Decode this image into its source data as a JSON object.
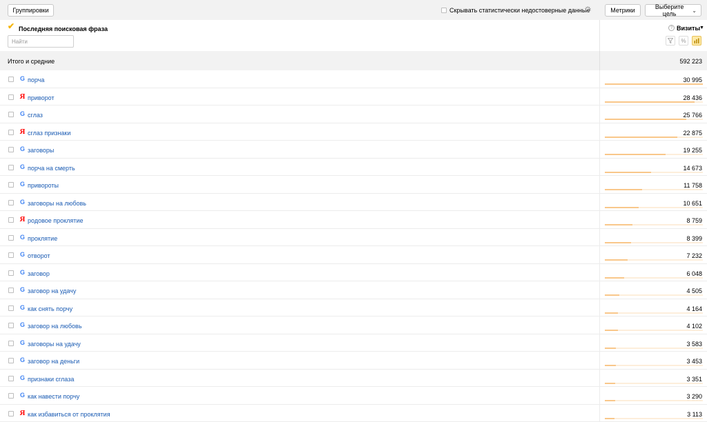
{
  "toolbar": {
    "groupings_label": "Группировки",
    "hide_unreliable_label": "Скрывать статистически недостоверные данные",
    "metrics_label": "Метрики",
    "goal_label": "Выберите цель"
  },
  "table": {
    "dimension_title": "Последняя поисковая фраза",
    "search_placeholder": "Найти",
    "metric_title": "Визиты",
    "totals_label": "Итого и средние",
    "totals_value": "592 223",
    "max_value": 30995,
    "rows": [
      {
        "source": "google",
        "phrase": "порча",
        "visits": "30 995",
        "value": 30995
      },
      {
        "source": "yandex",
        "phrase": "приворот",
        "visits": "28 436",
        "value": 28436
      },
      {
        "source": "google",
        "phrase": "сглаз",
        "visits": "25 766",
        "value": 25766
      },
      {
        "source": "yandex",
        "phrase": "сглаз признаки",
        "visits": "22 875",
        "value": 22875
      },
      {
        "source": "google",
        "phrase": "заговоры",
        "visits": "19 255",
        "value": 19255
      },
      {
        "source": "google",
        "phrase": "порча на смерть",
        "visits": "14 673",
        "value": 14673
      },
      {
        "source": "google",
        "phrase": "привороты",
        "visits": "11 758",
        "value": 11758
      },
      {
        "source": "google",
        "phrase": "заговоры на любовь",
        "visits": "10 651",
        "value": 10651
      },
      {
        "source": "yandex",
        "phrase": "родовое проклятие",
        "visits": "8 759",
        "value": 8759
      },
      {
        "source": "google",
        "phrase": "проклятие",
        "visits": "8 399",
        "value": 8399
      },
      {
        "source": "google",
        "phrase": "отворот",
        "visits": "7 232",
        "value": 7232
      },
      {
        "source": "google",
        "phrase": "заговор",
        "visits": "6 048",
        "value": 6048
      },
      {
        "source": "google",
        "phrase": "заговор на удачу",
        "visits": "4 505",
        "value": 4505
      },
      {
        "source": "google",
        "phrase": "как снять порчу",
        "visits": "4 164",
        "value": 4164
      },
      {
        "source": "google",
        "phrase": "заговор на любовь",
        "visits": "4 102",
        "value": 4102
      },
      {
        "source": "google",
        "phrase": "заговоры на удачу",
        "visits": "3 583",
        "value": 3583
      },
      {
        "source": "google",
        "phrase": "заговор на деньги",
        "visits": "3 453",
        "value": 3453
      },
      {
        "source": "google",
        "phrase": "признаки сглаза",
        "visits": "3 351",
        "value": 3351
      },
      {
        "source": "google",
        "phrase": "как навести порчу",
        "visits": "3 290",
        "value": 3290
      },
      {
        "source": "yandex",
        "phrase": "как избавиться от проклятия",
        "visits": "3 113",
        "value": 3113
      }
    ]
  },
  "icons": {
    "google": "google-icon",
    "yandex": "yandex-icon"
  },
  "colors": {
    "link": "#1a5bb3",
    "bar": "#f9c78a",
    "bar_track": "#fdeedb",
    "active_tool": "#fde9a6"
  }
}
